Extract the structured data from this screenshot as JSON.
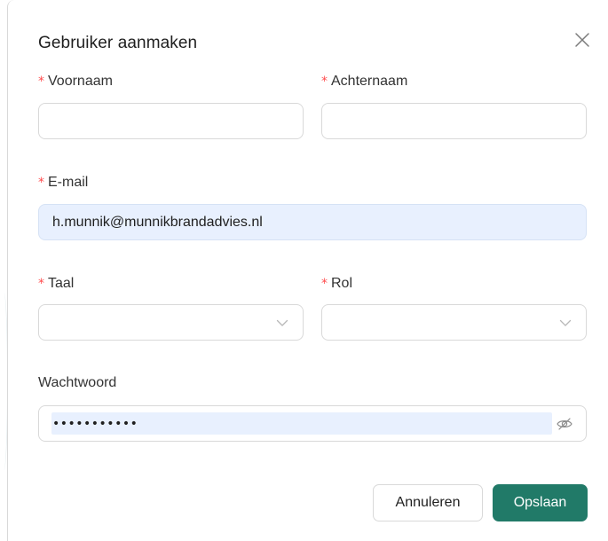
{
  "dialog": {
    "title": "Gebruiker aanmaken",
    "close_icon": "close-icon"
  },
  "form": {
    "required_marker": "*",
    "first_name": {
      "label": "Voornaam",
      "value": ""
    },
    "last_name": {
      "label": "Achternaam",
      "value": ""
    },
    "email": {
      "label": "E-mail",
      "value": "h.munnik@munnikbrandadvies.nl"
    },
    "language": {
      "label": "Taal",
      "value": "",
      "icon": "chevron-down-icon"
    },
    "role": {
      "label": "Rol",
      "value": "",
      "icon": "chevron-down-icon"
    },
    "password": {
      "label": "Wachtwoord",
      "masked_value": "•••••••••••",
      "icon": "eye-invisible-icon"
    }
  },
  "actions": {
    "cancel_label": "Annuleren",
    "save_label": "Opslaan"
  },
  "colors": {
    "primary": "#217a68",
    "required": "#ff4d4f",
    "autofill": "#e8f0fe",
    "border": "#d9d9d9"
  }
}
